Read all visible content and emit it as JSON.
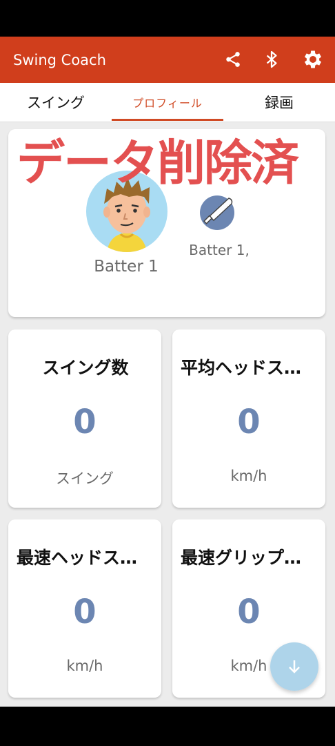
{
  "app": {
    "title": "Swing Coach",
    "icons": [
      "share-icon",
      "bluetooth-icon",
      "gear-icon"
    ],
    "accent_color": "#d03e1c"
  },
  "tabs": [
    {
      "label": "スイング",
      "active": false
    },
    {
      "label": "プロフィール",
      "active": true
    },
    {
      "label": "録画",
      "active": false
    }
  ],
  "profile": {
    "stamp": "データ削除済",
    "avatar_name": "Batter 1",
    "bat_name": "Batter 1,"
  },
  "stats": [
    {
      "title": "スイング数",
      "value": "0",
      "unit": "スイング"
    },
    {
      "title": "平均ヘッドスピード",
      "value": "0",
      "unit": "km/h"
    },
    {
      "title": "最速ヘッドスピード",
      "value": "0",
      "unit": "km/h"
    },
    {
      "title": "最速グリップスピード",
      "value": "0",
      "unit": "km/h"
    }
  ],
  "value_color": "#6c86b2"
}
